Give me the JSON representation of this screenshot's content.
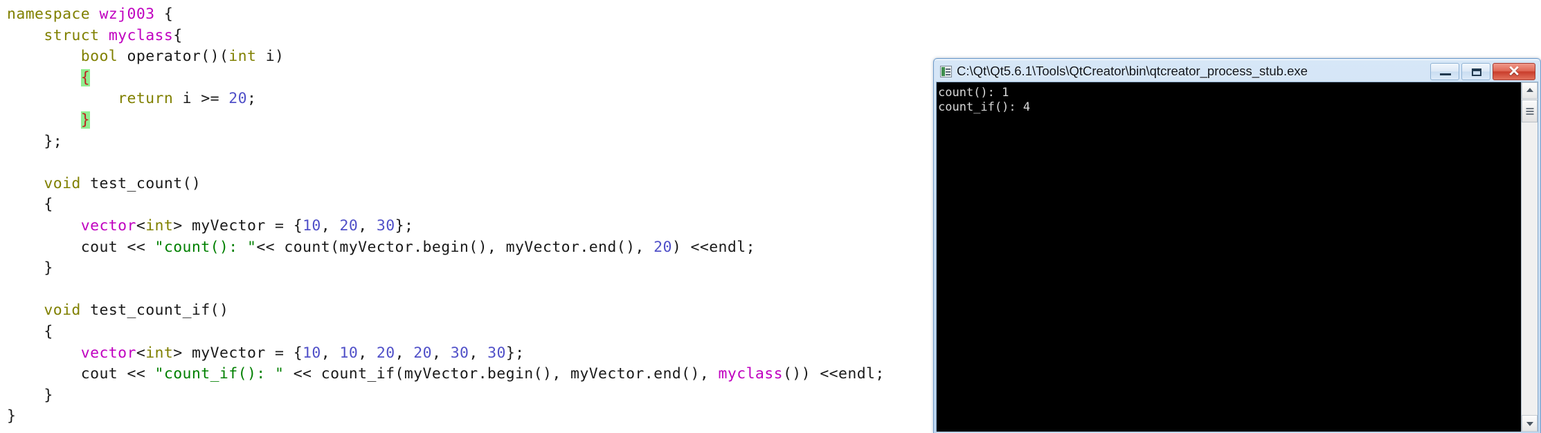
{
  "editor": {
    "language": "C++",
    "code_lines": [
      [
        {
          "t": "namespace ",
          "c": "kw"
        },
        {
          "t": "wzj003",
          "c": "typ"
        },
        {
          "t": " {",
          "c": "pl"
        }
      ],
      [
        {
          "t": "    ",
          "c": "pl"
        },
        {
          "t": "struct ",
          "c": "kw"
        },
        {
          "t": "myclass",
          "c": "typ"
        },
        {
          "t": "{",
          "c": "pl"
        }
      ],
      [
        {
          "t": "        ",
          "c": "pl"
        },
        {
          "t": "bool ",
          "c": "kw"
        },
        {
          "t": "operator()(",
          "c": "pl"
        },
        {
          "t": "int",
          "c": "kw"
        },
        {
          "t": " i)",
          "c": "pl"
        }
      ],
      [
        {
          "t": "        ",
          "c": "pl"
        },
        {
          "t": "{",
          "c": "brace-hl"
        }
      ],
      [
        {
          "t": "            ",
          "c": "pl"
        },
        {
          "t": "return",
          "c": "kw"
        },
        {
          "t": " i >= ",
          "c": "pl"
        },
        {
          "t": "20",
          "c": "num"
        },
        {
          "t": ";",
          "c": "pl"
        }
      ],
      [
        {
          "t": "        ",
          "c": "pl"
        },
        {
          "t": "}",
          "c": "brace-hl"
        }
      ],
      [
        {
          "t": "    };",
          "c": "pl"
        }
      ],
      [
        {
          "t": "",
          "c": "pl"
        }
      ],
      [
        {
          "t": "    ",
          "c": "pl"
        },
        {
          "t": "void ",
          "c": "kw"
        },
        {
          "t": "test_count()",
          "c": "pl"
        }
      ],
      [
        {
          "t": "    {",
          "c": "pl"
        }
      ],
      [
        {
          "t": "        ",
          "c": "pl"
        },
        {
          "t": "vector",
          "c": "typ"
        },
        {
          "t": "<",
          "c": "pl"
        },
        {
          "t": "int",
          "c": "kw"
        },
        {
          "t": "> myVector = {",
          "c": "pl"
        },
        {
          "t": "10",
          "c": "num"
        },
        {
          "t": ", ",
          "c": "pl"
        },
        {
          "t": "20",
          "c": "num"
        },
        {
          "t": ", ",
          "c": "pl"
        },
        {
          "t": "30",
          "c": "num"
        },
        {
          "t": "};",
          "c": "pl"
        }
      ],
      [
        {
          "t": "        cout << ",
          "c": "pl"
        },
        {
          "t": "\"count(): \"",
          "c": "str"
        },
        {
          "t": "<< count(myVector.begin(), myVector.end(), ",
          "c": "pl"
        },
        {
          "t": "20",
          "c": "num"
        },
        {
          "t": ") <<endl;",
          "c": "pl"
        }
      ],
      [
        {
          "t": "    }",
          "c": "pl"
        }
      ],
      [
        {
          "t": "",
          "c": "pl"
        }
      ],
      [
        {
          "t": "    ",
          "c": "pl"
        },
        {
          "t": "void ",
          "c": "kw"
        },
        {
          "t": "test_count_if()",
          "c": "pl"
        }
      ],
      [
        {
          "t": "    {",
          "c": "pl"
        }
      ],
      [
        {
          "t": "        ",
          "c": "pl"
        },
        {
          "t": "vector",
          "c": "typ"
        },
        {
          "t": "<",
          "c": "pl"
        },
        {
          "t": "int",
          "c": "kw"
        },
        {
          "t": "> myVector = {",
          "c": "pl"
        },
        {
          "t": "10",
          "c": "num"
        },
        {
          "t": ", ",
          "c": "pl"
        },
        {
          "t": "10",
          "c": "num"
        },
        {
          "t": ", ",
          "c": "pl"
        },
        {
          "t": "20",
          "c": "num"
        },
        {
          "t": ", ",
          "c": "pl"
        },
        {
          "t": "20",
          "c": "num"
        },
        {
          "t": ", ",
          "c": "pl"
        },
        {
          "t": "30",
          "c": "num"
        },
        {
          "t": ", ",
          "c": "pl"
        },
        {
          "t": "30",
          "c": "num"
        },
        {
          "t": "};",
          "c": "pl"
        }
      ],
      [
        {
          "t": "        cout << ",
          "c": "pl"
        },
        {
          "t": "\"count_if(): \"",
          "c": "str"
        },
        {
          "t": " << count_if(myVector.begin(), myVector.end(), ",
          "c": "pl"
        },
        {
          "t": "myclass",
          "c": "typ"
        },
        {
          "t": "()) <<endl;",
          "c": "pl"
        }
      ],
      [
        {
          "t": "    }",
          "c": "pl"
        }
      ],
      [
        {
          "t": "}",
          "c": "pl"
        }
      ]
    ],
    "colors": {
      "background": "#ffffff",
      "plain": "#1a1a1a",
      "keyword": "#808000",
      "type": "#c000c0",
      "string": "#008000",
      "number": "#5050c8",
      "brace_match_background": "#90ee90",
      "brace_match_text": "#c02020"
    }
  },
  "console_window": {
    "title": "C:\\Qt\\Qt5.6.1\\Tools\\QtCreator\\bin\\qtcreator_process_stub.exe",
    "icon": "console-app-icon",
    "buttons": {
      "minimize": "minimize-button",
      "maximize": "maximize-button",
      "close_label": "✕"
    },
    "output_lines": [
      "count(): 1",
      "count_if(): 4"
    ],
    "output_text": "count(): 1\ncount_if(): 4",
    "colors": {
      "titlebar": "#cadff4",
      "client_background": "#000000",
      "text": "#d8d8d8",
      "close_button": "#c93d2c"
    },
    "scrollbar": {
      "up_arrow": "scroll-up-arrow",
      "down_arrow": "scroll-down-arrow",
      "thumb": "scroll-thumb"
    }
  }
}
